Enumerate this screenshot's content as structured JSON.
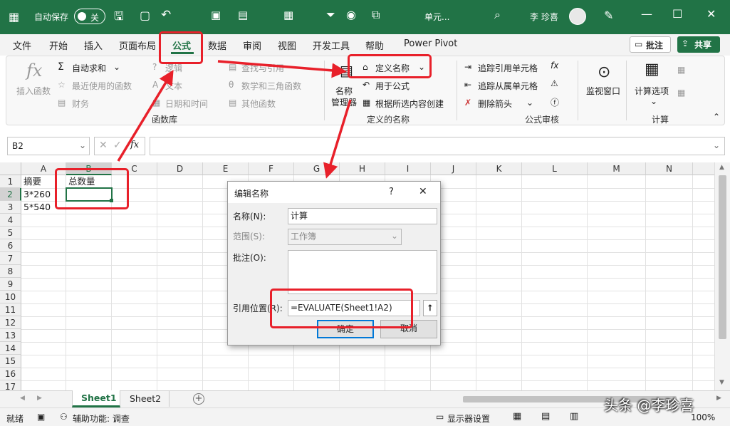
{
  "titlebar": {
    "autosave_label": "自动保存",
    "autosave_state": "关",
    "filename": "单元...",
    "user": "李 珍喜"
  },
  "menu": {
    "items": [
      "文件",
      "开始",
      "插入",
      "页面布局",
      "公式",
      "数据",
      "审阅",
      "视图",
      "开发工具",
      "帮助",
      "Power Pivot"
    ],
    "comment_btn": "批注",
    "share_btn": "共享"
  },
  "ribbon": {
    "insert_function": "插入函数",
    "autosum": "自动求和",
    "recent": "最近使用的函数",
    "finance": "财务",
    "logic": "逻辑",
    "text": "文本",
    "datetime": "日期和时间",
    "lookup": "查找与引用",
    "math": "数学和三角函数",
    "other": "其他函数",
    "group_library": "函数库",
    "name_manager_1": "名称",
    "name_manager_2": "管理器",
    "define_name": "定义名称",
    "use_in_formula": "用于公式",
    "create_from_selection": "根据所选内容创建",
    "group_names": "定义的名称",
    "trace_precedents": "追踪引用单元格",
    "trace_dependents": "追踪从属单元格",
    "remove_arrows": "删除箭头",
    "group_audit": "公式审核",
    "watch_window": "监视窗口",
    "calc_options": "计算选项",
    "group_calc": "计算"
  },
  "formulabar": {
    "namebox": "B2",
    "fx": "fx"
  },
  "grid": {
    "columns": [
      "A",
      "B",
      "C",
      "D",
      "E",
      "F",
      "G",
      "H",
      "I",
      "J",
      "K",
      "L",
      "M",
      "N"
    ],
    "rows": [
      "1",
      "2",
      "3",
      "4",
      "5",
      "6",
      "7",
      "8",
      "9",
      "10",
      "11",
      "12",
      "13",
      "14",
      "15",
      "16",
      "17"
    ],
    "cells": {
      "A1": "摘要",
      "B1": "总数量",
      "A2": "3*260",
      "A3": "5*540"
    }
  },
  "dialog": {
    "title": "编辑名称",
    "help": "?",
    "close": "✕",
    "name_label": "名称(N):",
    "name_value": "计算",
    "scope_label": "范围(S):",
    "scope_value": "工作簿",
    "comment_label": "批注(O):",
    "refers_label": "引用位置(R):",
    "refers_value": "=EVALUATE(Sheet1!A2)",
    "ok": "确定",
    "cancel": "取消"
  },
  "sheets": {
    "tabs": [
      "Sheet1",
      "Sheet2"
    ],
    "add": "+"
  },
  "status": {
    "ready": "就绪",
    "accessibility": "辅助功能: 调查",
    "display_settings": "显示器设置",
    "zoom": "100%"
  },
  "watermark": "头条 @李珍喜",
  "colors": {
    "excel_green": "#217346",
    "annotation_red": "#e8202a"
  }
}
